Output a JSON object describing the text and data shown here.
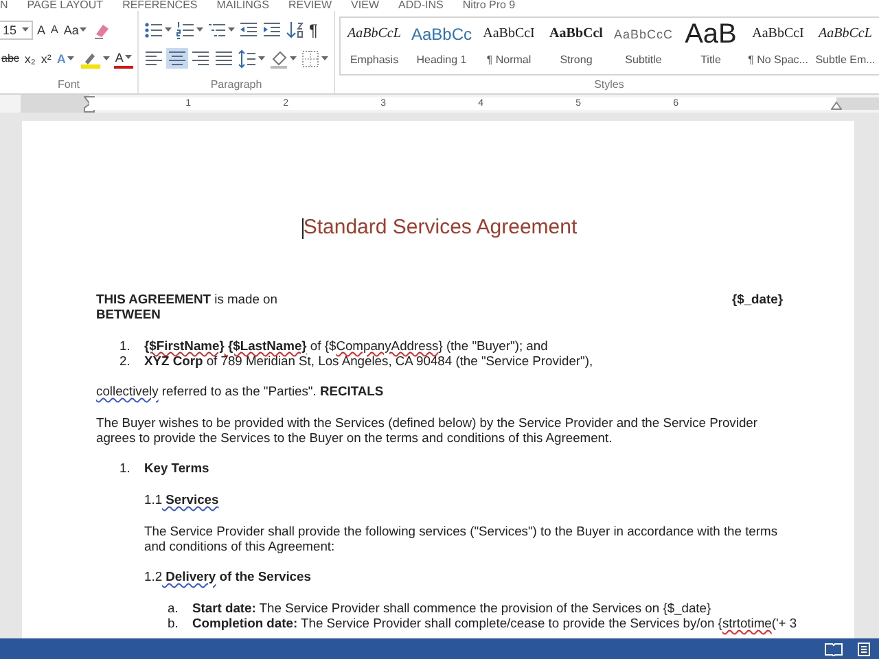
{
  "menu_tabs": [
    {
      "label": "N"
    },
    {
      "label": "PAGE LAYOUT"
    },
    {
      "label": "REFERENCES"
    },
    {
      "label": "MAILINGS"
    },
    {
      "label": "REVIEW"
    },
    {
      "label": "VIEW"
    },
    {
      "label": "ADD-INS"
    },
    {
      "label": "Nitro Pro 9"
    }
  ],
  "font_group": {
    "label": "Font",
    "font_size": "15",
    "row1": [
      {
        "kind": "grow",
        "label": "A",
        "dropdown": false
      },
      {
        "kind": "shrink",
        "label": "A",
        "dropdown": false
      },
      {
        "kind": "case",
        "label": "Aa",
        "dropdown": true
      },
      {
        "kind": "clear-format",
        "dropdown": false
      }
    ],
    "row2": [
      {
        "kind": "strike",
        "label": "abc",
        "dropdown": false
      },
      {
        "kind": "subscript",
        "label": "x₂",
        "dropdown": false
      },
      {
        "kind": "superscript",
        "label": "x²",
        "dropdown": false
      },
      {
        "kind": "effects",
        "label": "A",
        "dropdown": true
      },
      {
        "kind": "highlight",
        "dropdown": true
      },
      {
        "kind": "font-color",
        "label": "A",
        "dropdown": true
      }
    ]
  },
  "paragraph_group": {
    "label": "Paragraph",
    "row1": [
      {
        "kind": "bullets",
        "dropdown": true
      },
      {
        "kind": "numbering",
        "dropdown": true
      },
      {
        "kind": "multilevel",
        "dropdown": true
      },
      {
        "kind": "outdent",
        "dropdown": false
      },
      {
        "kind": "indent",
        "dropdown": false
      },
      {
        "kind": "sort",
        "dropdown": false
      },
      {
        "kind": "pilcrow",
        "label": "¶",
        "dropdown": false
      }
    ],
    "row2": [
      {
        "kind": "align-left",
        "dropdown": false,
        "selected": false
      },
      {
        "kind": "align-center",
        "dropdown": false,
        "selected": true
      },
      {
        "kind": "align-right",
        "dropdown": false,
        "selected": false
      },
      {
        "kind": "justify",
        "dropdown": false,
        "selected": false
      },
      {
        "kind": "line-spacing",
        "dropdown": true,
        "selected": false
      },
      {
        "kind": "shading",
        "dropdown": true,
        "selected": false
      },
      {
        "kind": "borders",
        "dropdown": true,
        "selected": false
      }
    ]
  },
  "styles_group": {
    "label": "Styles",
    "styles": [
      {
        "kind": "emphasis",
        "sample": "AaBbCcL",
        "name": "Emphasis"
      },
      {
        "kind": "heading",
        "sample": "AaBbCc",
        "name": "Heading 1"
      },
      {
        "kind": "normal",
        "sample": "AaBbCcI",
        "name": "¶ Normal"
      },
      {
        "kind": "strong",
        "sample": "AaBbCcl",
        "name": "Strong"
      },
      {
        "kind": "subtitle",
        "sample": "AaBbCcC",
        "name": "Subtitle"
      },
      {
        "kind": "title",
        "sample": "AaB",
        "name": "Title"
      },
      {
        "kind": "normal",
        "sample": "AaBbCcI",
        "name": "¶ No Spac..."
      },
      {
        "kind": "emphasis",
        "sample": "AaBbCcL",
        "name": "Subtle Em..."
      }
    ]
  },
  "ruler": {
    "numbers": [
      "1",
      "2",
      "3",
      "4",
      "5",
      "6"
    ]
  },
  "document": {
    "title": "Standard Services Agreement",
    "blocks": [
      {
        "kind": "split-line",
        "runs": [
          {
            "text": "THIS AGREEMENT",
            "kind": "bold"
          },
          {
            "text": " is made on",
            "kind": "plain"
          }
        ],
        "aside": [
          {
            "text": "{$_date}",
            "kind": "bold"
          }
        ]
      },
      {
        "kind": "line",
        "runs": [
          {
            "text": "BETWEEN",
            "kind": "bold"
          }
        ]
      },
      {
        "kind": "list",
        "items": [
          {
            "marker": "1.",
            "runs": [
              {
                "text": "{$FirstName}",
                "kind": "bold-spelling"
              },
              {
                "text": " {$LastName}",
                "kind": "bold-spelling"
              },
              {
                "text": " of {$",
                "kind": "plain"
              },
              {
                "text": "CompanyAddress",
                "kind": "spelling"
              },
              {
                "text": "} (the \"Buyer\"); and",
                "kind": "plain"
              }
            ]
          },
          {
            "marker": "2.",
            "runs": [
              {
                "text": "XYZ Corp",
                "kind": "bold"
              },
              {
                "text": " of 789 Meridian St, Los Angeles, CA 90484 (the \"Service Provider\"),",
                "kind": "plain"
              }
            ]
          }
        ]
      },
      {
        "kind": "para",
        "runs": [
          {
            "text": "collectively",
            "kind": "grammar"
          },
          {
            "text": " referred to as the \"Parties\". ",
            "kind": "plain"
          },
          {
            "text": "RECITALS",
            "kind": "bold"
          }
        ]
      },
      {
        "kind": "para",
        "runs": [
          {
            "text": "The Buyer wishes to be provided with the Services (defined below) by the Service Provider and the Service Provider agrees to provide the Services to the Buyer on the terms and conditions of this Agreement.",
            "kind": "plain"
          }
        ]
      },
      {
        "kind": "list",
        "items": [
          {
            "marker": "1.",
            "runs": [
              {
                "text": "Key Terms",
                "kind": "bold"
              }
            ],
            "children": [
              {
                "kind": "para",
                "runs": [
                  {
                    "text": "1.1",
                    "kind": "plain"
                  },
                  {
                    "text": " Services",
                    "kind": "bold-grammar"
                  }
                ]
              },
              {
                "kind": "para",
                "runs": [
                  {
                    "text": "The Service Provider shall provide the following services (\"Services\") to the Buyer in accordance with the terms and conditions of this Agreement:",
                    "kind": "plain"
                  }
                ]
              },
              {
                "kind": "para",
                "runs": [
                  {
                    "text": "1.2",
                    "kind": "plain"
                  },
                  {
                    "text": " Delivery",
                    "kind": "bold-grammar"
                  },
                  {
                    "text": " of the Services",
                    "kind": "bold"
                  }
                ]
              },
              {
                "kind": "list",
                "items": [
                  {
                    "marker": "a.",
                    "runs": [
                      {
                        "text": "Start date:",
                        "kind": "bold"
                      },
                      {
                        "text": " The Service Provider shall commence the provision of the Services on {$_date}",
                        "kind": "plain"
                      }
                    ]
                  },
                  {
                    "marker": "b.",
                    "runs": [
                      {
                        "text": "Completion date:",
                        "kind": "bold"
                      },
                      {
                        "text": " The Service Provider shall complete/cease to provide the Services by/on {",
                        "kind": "plain"
                      },
                      {
                        "text": "strtotime",
                        "kind": "spelling"
                      },
                      {
                        "text": "('+ 3",
                        "kind": "plain"
                      }
                    ]
                  }
                ]
              }
            ]
          }
        ]
      }
    ]
  }
}
